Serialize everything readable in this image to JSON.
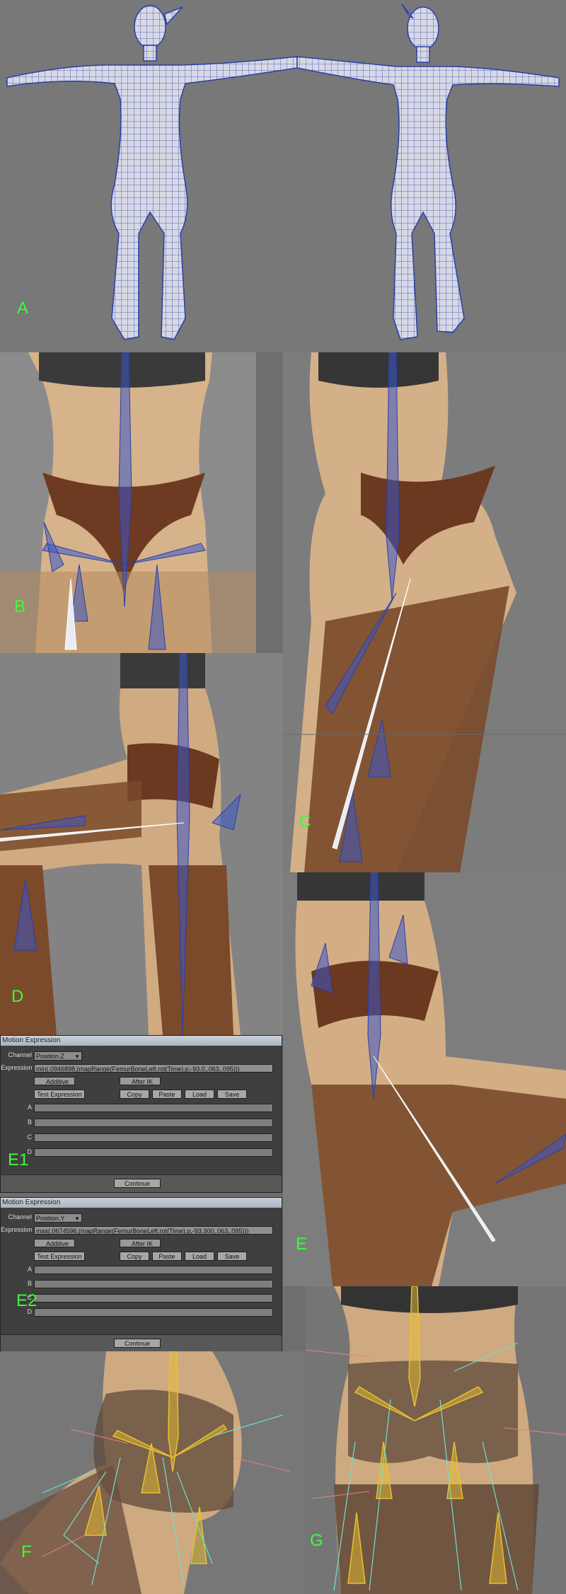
{
  "panels": [
    {
      "id": "A",
      "label": "A"
    },
    {
      "id": "B",
      "label": "B"
    },
    {
      "id": "C",
      "label": "C"
    },
    {
      "id": "D",
      "label": "D"
    },
    {
      "id": "E",
      "label": "E"
    },
    {
      "id": "F",
      "label": "F"
    },
    {
      "id": "G",
      "label": "G"
    }
  ],
  "dialog1": {
    "title": "Motion Expression",
    "overlay_label": "E1",
    "channel_label": "Channel",
    "channel_value": "Position.Z",
    "expression_label": "Expression",
    "expression_value": "min(.0946898,(mapRange(FemurBoneLeft.rot(Time).p,-93.0,.063,.095)))",
    "additive_label": "Additive",
    "after_ik_label": "After IK",
    "test_label": "Test Expression",
    "copy_label": "Copy",
    "paste_label": "Paste",
    "load_label": "Load",
    "save_label": "Save",
    "var_a": "A",
    "var_b": "B",
    "var_c": "C",
    "var_d": "D",
    "continue_label": "Continue"
  },
  "dialog2": {
    "title": "Motion Expression",
    "overlay_label": "E2",
    "channel_label": "Channel",
    "channel_value": "Position.Y",
    "expression_label": "Expression",
    "expression_value": "max(.0674596,(mapRange(FemurBoneLeft.rot(Time).p,-93,300,.063,.095)))",
    "additive_label": "Additive",
    "after_ik_label": "After IK",
    "test_label": "Test Expression",
    "copy_label": "Copy",
    "paste_label": "Paste",
    "load_label": "Load",
    "save_label": "Save",
    "var_a": "A",
    "var_b": "B",
    "var_c": "C",
    "var_d": "D",
    "continue_label": "Continue"
  },
  "colors": {
    "label_green": "#39ff39",
    "wire_blue": "#2a3fa8",
    "bone_blue": "#3a56c8",
    "skin": "#c9a27c",
    "stocking": "#7a4a2a",
    "dialog_bg": "#3f3f3f"
  }
}
